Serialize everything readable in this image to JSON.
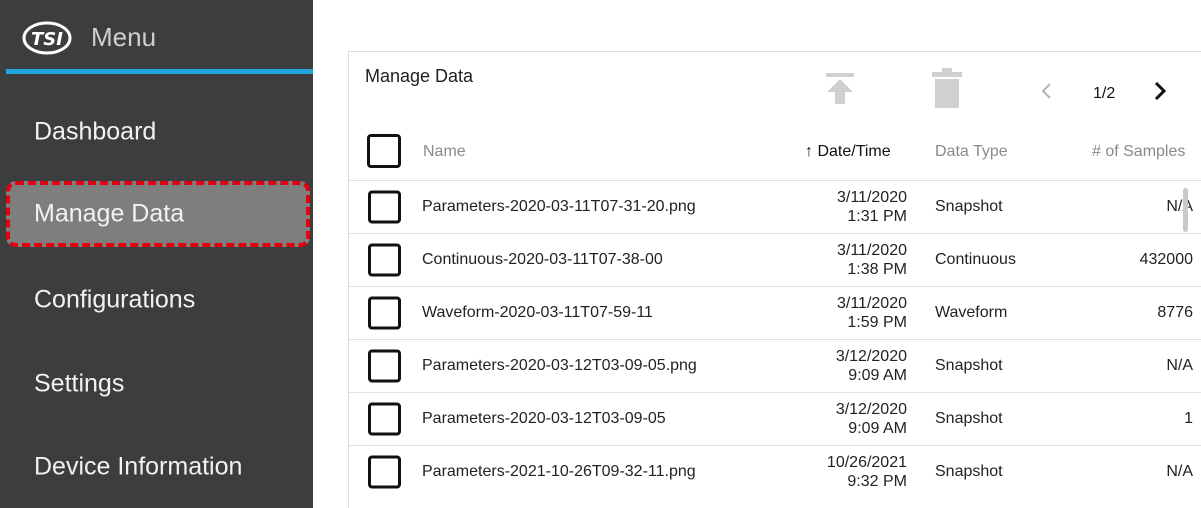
{
  "sidebar": {
    "menu_title": "Menu",
    "logo_text": "TSI",
    "items": [
      {
        "label": "Dashboard"
      },
      {
        "label": "Manage Data"
      },
      {
        "label": "Configurations"
      },
      {
        "label": "Settings"
      },
      {
        "label": "Device Information"
      }
    ]
  },
  "panel": {
    "title": "Manage Data",
    "pagination": "1/2",
    "columns": {
      "name": "Name",
      "datetime": "↑ Date/Time",
      "type": "Data Type",
      "samples": "# of Samples"
    },
    "rows": [
      {
        "name": "Parameters-2020-03-11T07-31-20.png",
        "date": "3/11/2020",
        "time": "1:31 PM",
        "type": "Snapshot",
        "samples": "N/A"
      },
      {
        "name": "Continuous-2020-03-11T07-38-00",
        "date": "3/11/2020",
        "time": "1:38 PM",
        "type": "Continuous",
        "samples": "432000"
      },
      {
        "name": "Waveform-2020-03-11T07-59-11",
        "date": "3/11/2020",
        "time": "1:59 PM",
        "type": "Waveform",
        "samples": "8776"
      },
      {
        "name": "Parameters-2020-03-12T03-09-05.png",
        "date": "3/12/2020",
        "time": "9:09 AM",
        "type": "Snapshot",
        "samples": "N/A"
      },
      {
        "name": "Parameters-2020-03-12T03-09-05",
        "date": "3/12/2020",
        "time": "9:09 AM",
        "type": "Snapshot",
        "samples": "1"
      },
      {
        "name": "Parameters-2021-10-26T09-32-11.png",
        "date": "10/26/2021",
        "time": "9:32 PM",
        "type": "Snapshot",
        "samples": "N/A"
      }
    ]
  },
  "colors": {
    "sidebar_bg": "#3d3d3d",
    "accent": "#20a7e0",
    "active_item_bg": "#7e7e7e",
    "highlight_border": "#e0000f",
    "disabled_icon": "#d0d0d0"
  },
  "icons": [
    "tsi-logo-icon",
    "upload-icon",
    "trash-icon",
    "chevron-left-icon",
    "chevron-right-icon"
  ]
}
